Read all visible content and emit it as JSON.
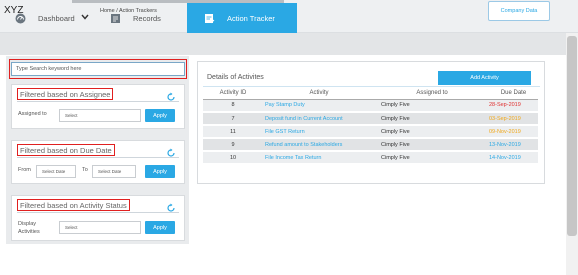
{
  "tabs": [
    {
      "label": "Dashboard",
      "icon": "speedometer-icon"
    },
    {
      "label": "Records",
      "icon": "records-icon"
    },
    {
      "label": "Action Tracker",
      "icon": "action-tracker-icon",
      "active": true
    }
  ],
  "subbar": {
    "company": "XYZ",
    "breadcrumb": "Home  /  Action Trackers",
    "company_data_label": "Company Data"
  },
  "search": {
    "placeholder": "Type Search keyword here"
  },
  "filters": {
    "assignee": {
      "title": "Filtered based on Assignee",
      "label": "Assigned to",
      "select": "Select",
      "apply": "Apply"
    },
    "due_date": {
      "title": "Filtered based on Due Date",
      "from_label": "From",
      "from_placeholder": "Select Date",
      "to_label": "To",
      "to_placeholder": "Select Date",
      "apply": "Apply"
    },
    "status": {
      "title": "Filtered based on Activity Status",
      "label_line1": "Display",
      "label_line2": "Activities",
      "select": "Select",
      "apply": "Apply"
    }
  },
  "details": {
    "title": "Details of Activites",
    "add_button": "Add Activity",
    "columns": [
      "Activity ID",
      "Activity",
      "Assigned to",
      "Due Date"
    ],
    "rows": [
      {
        "id": "8",
        "activity": "Pay Stamp Duty",
        "assigned": "Cimply Five",
        "due": "28-Sep-2019",
        "due_color": "red"
      },
      {
        "id": "7",
        "activity": "Deposit fund in Current Account",
        "assigned": "Cimply Five",
        "due": "03-Sep-2019",
        "due_color": "yellow"
      },
      {
        "id": "11",
        "activity": "File GST Return",
        "assigned": "Cimply Five",
        "due": "09-Nov-2019",
        "due_color": "yellow"
      },
      {
        "id": "9",
        "activity": "Refund amount to Stakeholders",
        "assigned": "Cimply Five",
        "due": "13-Nov-2019",
        "due_color": "blue"
      },
      {
        "id": "10",
        "activity": "File Income Tax Return",
        "assigned": "Cimply Five",
        "due": "14-Nov-2019",
        "due_color": "blue"
      }
    ]
  },
  "colors": {
    "accent": "#2aa8e4",
    "highlight": "#e02020",
    "overdue": "#e03030",
    "upcoming": "#f0a81a"
  }
}
